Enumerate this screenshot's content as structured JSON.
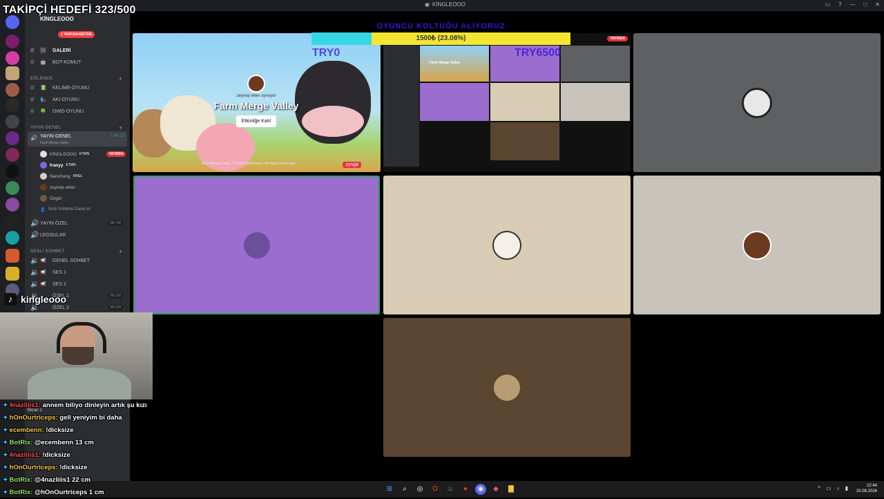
{
  "window": {
    "title": "KİNGLEOOO"
  },
  "overlay": {
    "goal": "TAKİPÇİ HEDEFİ 323/500",
    "tiktok_name": "kingleooo",
    "donation_title": "OYUNCU KOLTUĞU ALIYORUZ",
    "donation_progress": "1500₺ (23.08%)",
    "donation_fraction": 0.2308,
    "try_left": "TRY0",
    "try_right": "TRY6500"
  },
  "sidebar": {
    "guild_name": "KİNGLEOOO",
    "new_badge": "1 YENİ BAHSETME",
    "channels_top": [
      {
        "label": "GALERİ",
        "emoji": "🖼"
      },
      {
        "label": "BOT-KOMUT",
        "emoji": "🤖"
      }
    ],
    "category_fun": "EĞLENCE",
    "channels_fun": [
      {
        "label": "KELİME-OYUNU",
        "emoji": "📗"
      },
      {
        "label": "AKI-OYUNU",
        "emoji": "🧞"
      },
      {
        "label": "OWO-OYUNU",
        "emoji": "🍀"
      }
    ],
    "category_stream": "YAYIN GENEL",
    "voice_active": {
      "name": "YAYIN GENEL",
      "activity": "Farm Merge Valley",
      "time": "1:44:13"
    },
    "voice_users": [
      {
        "name": "KİNGLEOOO",
        "tag": "KTMN",
        "live": "YAYINDA",
        "color": "#e1dfd8"
      },
      {
        "name": "franyy",
        "tag": "KTMN",
        "live": "",
        "color": "#7d6bd8"
      },
      {
        "name": "Nanchang",
        "tag": "KNGL",
        "live": "",
        "color": "#d6cfbf"
      },
      {
        "name": "zeynep ekler",
        "tag": "",
        "live": "",
        "color": "#6b3a1f"
      },
      {
        "name": "Özgür",
        "tag": "",
        "live": "",
        "color": "#6b5a3d"
      }
    ],
    "invite": "Sesli Sohbete Davet et",
    "voice_other": [
      {
        "label": "YAYIN ÖZEL",
        "count": "00 | 99"
      },
      {
        "label": "LEOSULAR",
        "count": ""
      }
    ],
    "category_voice": "SESLİ SOHBET",
    "voice_channels": [
      {
        "label": "GENEL SOHBET",
        "count": ""
      },
      {
        "label": "SES 1",
        "count": ""
      },
      {
        "label": "SES 2",
        "count": ""
      },
      {
        "label": "ÖZEL 1",
        "count": "00 | 02"
      },
      {
        "label": "ÖZEL 2",
        "count": "00 | 03"
      }
    ],
    "connection_label": "Ekran 1"
  },
  "chat": [
    {
      "user": "4nazliiis1:",
      "text": "annem biliyo dinleyin artık şu kızı",
      "color": "#ff4d4d"
    },
    {
      "user": "hOnOurtriceps:",
      "text": "gell yeniyim bi daha",
      "color": "#f5c84c"
    },
    {
      "user": "ecembenn:",
      "text": "!dicksize",
      "color": "#f5c84c"
    },
    {
      "user": "BotRix:",
      "text": "@ecembenn 13 cm",
      "color": "#9ae36b"
    },
    {
      "user": "4nazliiis1:",
      "text": "!dicksize",
      "color": "#ff4d4d"
    },
    {
      "user": "hOnOurtriceps:",
      "text": "!dicksize",
      "color": "#f5c84c"
    },
    {
      "user": "BotRix:",
      "text": "@4nazliiis1 22 cm",
      "color": "#9ae36b"
    },
    {
      "user": "BotRix:",
      "text": "@hOnOurtriceps 1 cm",
      "color": "#9ae36b"
    }
  ],
  "stage": {
    "game": {
      "playing": "zeynep ekler oynuyor",
      "title": "Farm Merge Valley",
      "join": "Etkinliğe Katıl",
      "copyright": "Farm Merge Valley. © 2024 CoolGames. All Rights Reserved.",
      "brand": "zynga"
    },
    "share_live": "YAYINDA",
    "share_game": "Farm Merge Valley",
    "tiles": [
      {
        "name": "leo-tile",
        "bg": "#5f6061",
        "avatar": "#e8e8e8"
      },
      {
        "name": "franyy-tile",
        "bg": "#9a6dcf",
        "avatar": "#6b4f9a"
      },
      {
        "name": "nanchang-tile",
        "bg": "#d8cdb4",
        "avatar": "#f4f0e8"
      },
      {
        "name": "zeynep-tile",
        "bg": "#c8c4bb",
        "avatar": "#6b3a1f"
      },
      {
        "name": "ozgur-tile",
        "bg": "#5a4630",
        "avatar": "#b89d72"
      }
    ]
  },
  "taskbar": {
    "time": "22:44",
    "date": "20.08.2026"
  }
}
